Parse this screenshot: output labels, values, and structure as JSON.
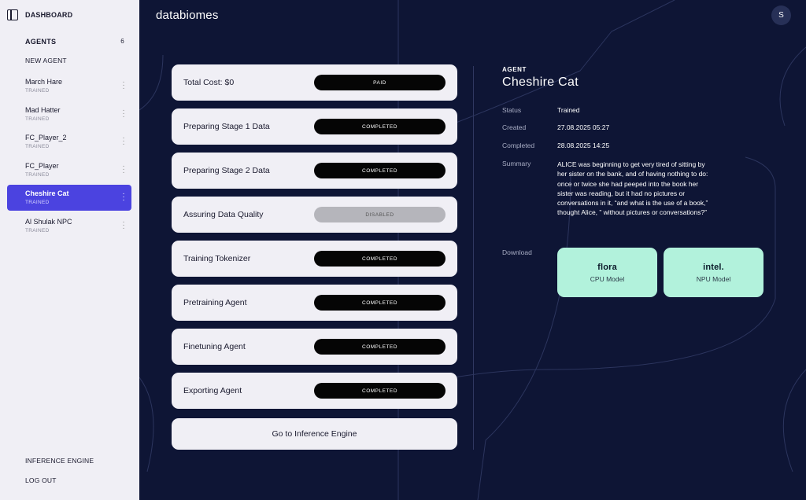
{
  "header": {
    "logo": "databiomes",
    "avatar_initial": "S"
  },
  "sidebar": {
    "dashboard": "DASHBOARD",
    "agents_heading": "AGENTS",
    "agents_count": "6",
    "new_agent": "NEW AGENT",
    "agents": [
      {
        "name": "March Hare",
        "status": "TRAINED"
      },
      {
        "name": "Mad Hatter",
        "status": "TRAINED"
      },
      {
        "name": "FC_Player_2",
        "status": "TRAINED"
      },
      {
        "name": "FC_Player",
        "status": "TRAINED"
      },
      {
        "name": "Cheshire Cat",
        "status": "TRAINED"
      },
      {
        "name": "Al Shulak NPC",
        "status": "TRAINED"
      }
    ],
    "inference_engine": "INFERENCE ENGINE",
    "log_out": "LOG OUT"
  },
  "stages": [
    {
      "label": "Total Cost: $0",
      "status": "PAID"
    },
    {
      "label": "Preparing Stage 1 Data",
      "status": "COMPLETED"
    },
    {
      "label": "Preparing Stage 2 Data",
      "status": "COMPLETED"
    },
    {
      "label": "Assuring Data Quality",
      "status": "DISABLED"
    },
    {
      "label": "Training Tokenizer",
      "status": "COMPLETED"
    },
    {
      "label": "Pretraining Agent",
      "status": "COMPLETED"
    },
    {
      "label": "Finetuning Agent",
      "status": "COMPLETED"
    },
    {
      "label": "Exporting Agent",
      "status": "COMPLETED"
    }
  ],
  "goto_button": "Go to Inference Engine",
  "detail": {
    "kicker": "AGENT",
    "title": "Cheshire Cat",
    "status_key": "Status",
    "status_val": "Trained",
    "created_key": "Created",
    "created_val": "27.08.2025 05:27",
    "completed_key": "Completed",
    "completed_val": "28.08.2025 14:25",
    "summary_key": "Summary",
    "summary_val": "ALICE was beginning to get very tired of sitting by her sister on the bank, and of having nothing to do: once or twice she had peeped into the book her sister was reading, but it had no pictures or conversations in it, “and what is the use of a book,” thought Alice, ” without pictures or conversations?”",
    "download_key": "Download",
    "downloads": [
      {
        "brand": "flora",
        "model": "CPU Model"
      },
      {
        "brand": "intel.",
        "model": "NPU Model"
      }
    ]
  },
  "colors": {
    "background": "#0e1535",
    "sidebar": "#f0eff5",
    "accent": "#4b43e0",
    "download": "#b2f2dc"
  }
}
